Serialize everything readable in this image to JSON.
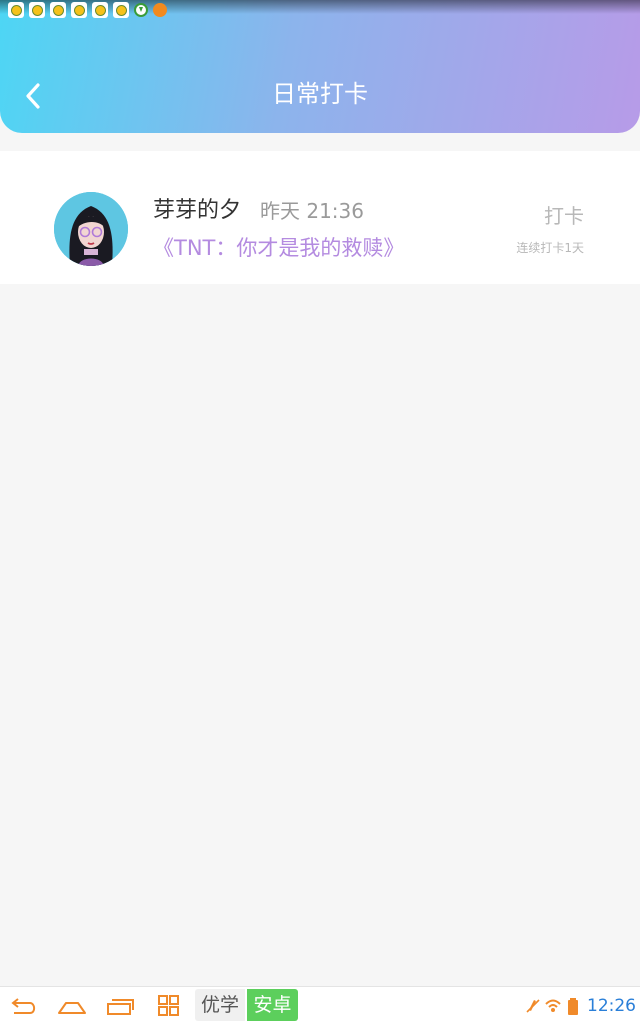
{
  "status_bar": {
    "notification_icons": [
      "app-notification-icon",
      "app-notification-icon",
      "app-notification-icon",
      "app-notification-icon",
      "app-notification-icon",
      "app-notification-icon",
      "download-icon",
      "alert-icon"
    ]
  },
  "header": {
    "title": "日常打卡",
    "back_icon": "chevron-left-icon",
    "gradient_colors": [
      "#4dd6f4",
      "#b79be8"
    ]
  },
  "checkin_list": {
    "items": [
      {
        "username": "芽芽的夕",
        "time": "昨天 21:36",
        "book_title": "《TNT：你才是我的救赎》",
        "action_label": "打卡",
        "streak": "连续打卡1天"
      }
    ]
  },
  "nav_bar": {
    "brand_left": "优学",
    "brand_right": "安卓",
    "clock": "12:26",
    "icons": [
      "back-icon",
      "home-icon",
      "recent-apps-icon",
      "apps-grid-icon",
      "mute-icon",
      "wifi-icon",
      "battery-icon"
    ]
  },
  "colors": {
    "accent": "#b48be0",
    "brand_green": "#5ccf5c",
    "clock_blue": "#2a7fd8"
  }
}
